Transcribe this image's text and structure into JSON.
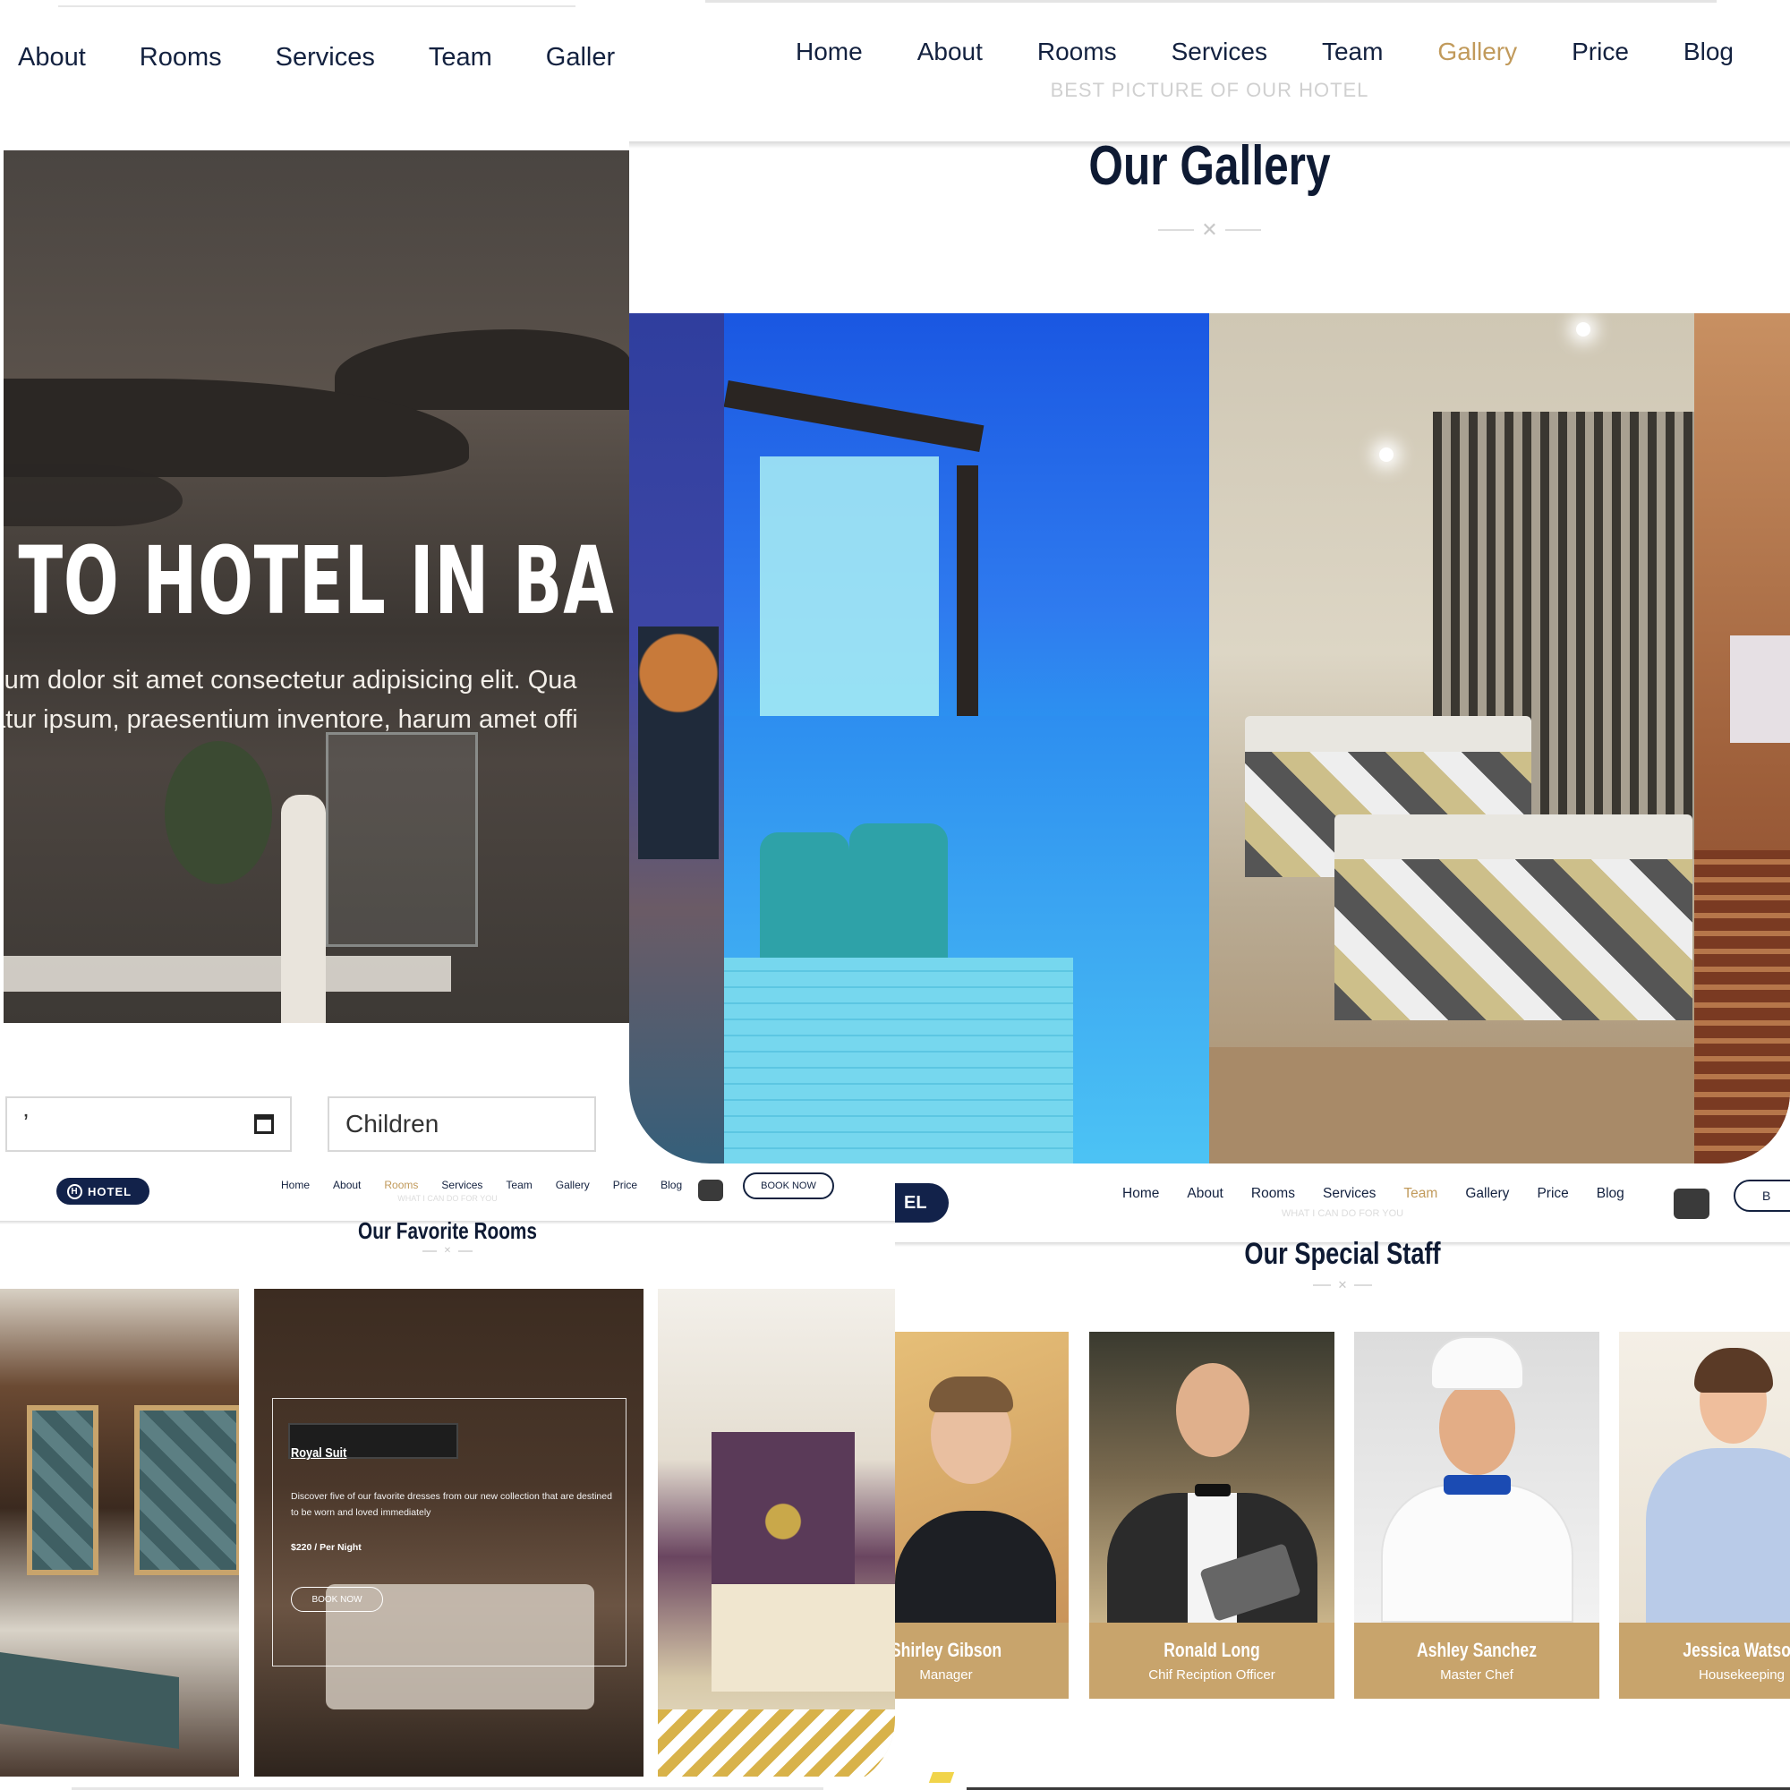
{
  "hero_panel": {
    "nav": [
      "About",
      "Rooms",
      "Services",
      "Team",
      "Galler"
    ],
    "heading": "E TO HOTEL IN BA",
    "text_line1": "psum dolor sit amet consectetur adipisicing elit. Qua",
    "text_line2": "natur ipsum, praesentium inventore, harum amet offi",
    "date_value": "ʼ",
    "children_placeholder": "Children"
  },
  "gallery_panel": {
    "nav": [
      "Home",
      "About",
      "Rooms",
      "Services",
      "Team",
      "Gallery",
      "Price",
      "Blog"
    ],
    "active_nav": "Gallery",
    "subtitle": "BEST PICTURE OF OUR HOTEL",
    "title": "Our Gallery"
  },
  "rooms_panel": {
    "logo": "HOTEL",
    "nav": [
      "Home",
      "About",
      "Rooms",
      "Services",
      "Team",
      "Gallery",
      "Price",
      "Blog"
    ],
    "active_nav": "Rooms",
    "book_now": "BOOK NOW",
    "subtitle": "WHAT I CAN DO FOR YOU",
    "title": "Our Favorite Rooms",
    "featured_room": {
      "name": "Royal Suit",
      "description": "Discover five of our favorite dresses from our new collection that are destined to be worn and loved immediately",
      "price": "$220 / Per Night",
      "button": "BOOK NOW"
    }
  },
  "staff_panel": {
    "logo": "EL",
    "nav": [
      "Home",
      "About",
      "Rooms",
      "Services",
      "Team",
      "Gallery",
      "Price",
      "Blog"
    ],
    "active_nav": "Team",
    "book_now": "B",
    "subtitle": "WHAT I CAN DO FOR YOU",
    "title": "Our Special Staff",
    "members": [
      {
        "name": "Shirley Gibson",
        "role": "Manager"
      },
      {
        "name": "Ronald Long",
        "role": "Chif Reciption Officer"
      },
      {
        "name": "Ashley Sanchez",
        "role": "Master Chef"
      },
      {
        "name": "Jessica Watson",
        "role": "Housekeeping"
      }
    ]
  },
  "colors": {
    "navy": "#0e1a33",
    "gold": "#c8a46c",
    "active_link": "#c19a5b"
  }
}
